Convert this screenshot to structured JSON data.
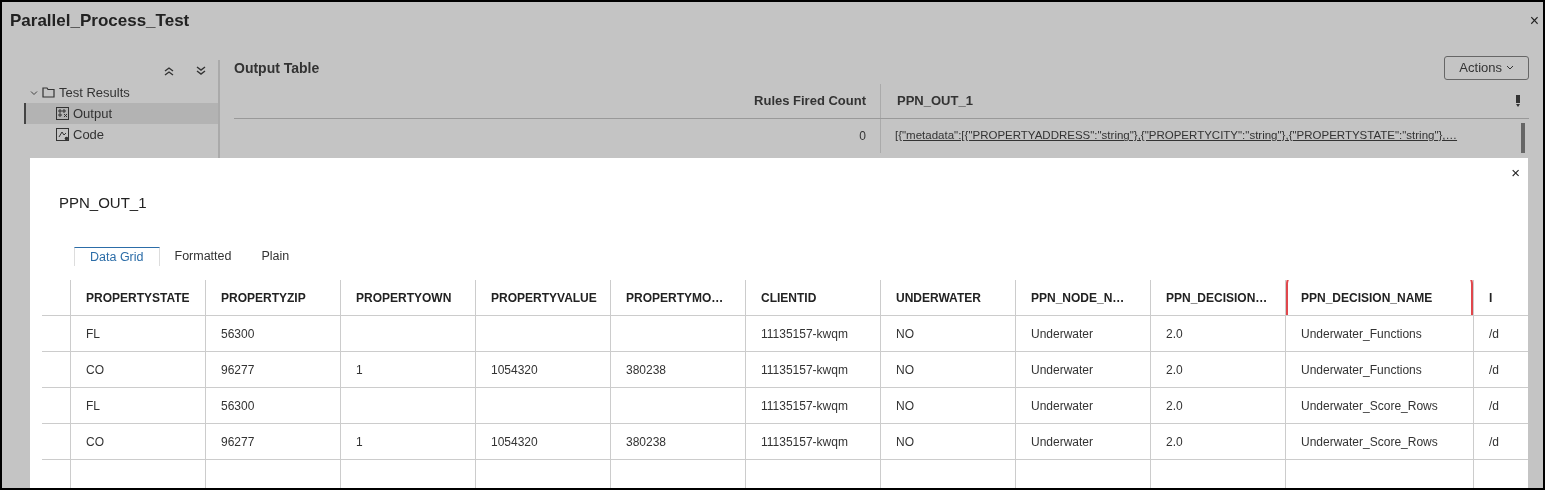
{
  "window": {
    "title": "Parallel_Process_Test",
    "close": "×"
  },
  "sidebar": {
    "items": [
      {
        "label": "Test Results",
        "expanded": true,
        "kind": "folder",
        "children": [
          {
            "label": "Output",
            "kind": "output",
            "selected": true
          },
          {
            "label": "Code",
            "kind": "code",
            "selected": false
          }
        ]
      }
    ]
  },
  "output_table": {
    "title": "Output Table",
    "actions": "Actions",
    "columns": [
      "Rules Fired Count",
      "PPN_OUT_1"
    ],
    "rows": [
      [
        "0",
        "[{\"metadata\":[{\"PROPERTYADDRESS\":\"string\"},{\"PROPERTYCITY\":\"string\"},{\"PROPERTYSTATE\":\"string\"},…"
      ]
    ]
  },
  "dialog": {
    "title": "PPN_OUT_1",
    "close": "×",
    "tabs": [
      {
        "label": "Data Grid",
        "selected": true
      },
      {
        "label": "Formatted",
        "selected": false
      },
      {
        "label": "Plain",
        "selected": false
      }
    ],
    "grid": {
      "columns": [
        {
          "label": "PROPERTYSTATE",
          "highlighted": false
        },
        {
          "label": "PROPERTYZIP",
          "highlighted": false
        },
        {
          "label": "PROPERTYOWN",
          "highlighted": false
        },
        {
          "label": "PROPERTYVALUE",
          "highlighted": false
        },
        {
          "label": "PROPERTYMO…",
          "highlighted": false
        },
        {
          "label": "CLIENTID",
          "highlighted": false
        },
        {
          "label": "UNDERWATER",
          "highlighted": false
        },
        {
          "label": "PPN_NODE_N…",
          "highlighted": false
        },
        {
          "label": "PPN_DECISION…",
          "highlighted": false
        },
        {
          "label": "PPN_DECISION_NAME",
          "highlighted": true
        },
        {
          "label": "I",
          "highlighted": false
        }
      ],
      "rows": [
        [
          "FL",
          "56300",
          "",
          "",
          "",
          "11135157-kwqm",
          "NO",
          "Underwater",
          "2.0",
          "Underwater_Functions",
          "/d"
        ],
        [
          "CO",
          "96277",
          "1",
          "1054320",
          "380238",
          "11135157-kwqm",
          "NO",
          "Underwater",
          "2.0",
          "Underwater_Functions",
          "/d"
        ],
        [
          "FL",
          "56300",
          "",
          "",
          "",
          "11135157-kwqm",
          "NO",
          "Underwater",
          "2.0",
          "Underwater_Score_Rows",
          "/d"
        ],
        [
          "CO",
          "96277",
          "1",
          "1054320",
          "380238",
          "11135157-kwqm",
          "NO",
          "Underwater",
          "2.0",
          "Underwater_Score_Rows",
          "/d"
        ]
      ]
    }
  }
}
